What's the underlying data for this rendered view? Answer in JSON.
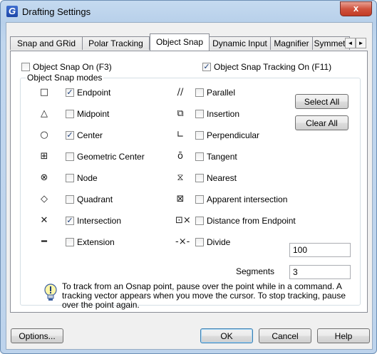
{
  "window": {
    "title": "Drafting Settings",
    "close_glyph": "x"
  },
  "tabs": [
    {
      "label": "Snap and GRid"
    },
    {
      "label": "Polar Tracking"
    },
    {
      "label": "Object Snap",
      "active": true
    },
    {
      "label": "Dynamic Input"
    },
    {
      "label": "Magnifier"
    },
    {
      "label": "Symmetr"
    }
  ],
  "tab_scroll": {
    "left": "◄",
    "right": "►"
  },
  "options": {
    "snap_on": {
      "label": "Object Snap On (F3)",
      "checked": false
    },
    "tracking_on": {
      "label": "Object Snap Tracking On (F11)",
      "checked": true
    }
  },
  "group_title": "Object Snap modes",
  "modes_left": [
    {
      "label": "Endpoint",
      "checked": true,
      "icon": "□"
    },
    {
      "label": "Midpoint",
      "checked": false,
      "icon": "△"
    },
    {
      "label": "Center",
      "checked": true,
      "icon": "○"
    },
    {
      "label": "Geometric Center",
      "checked": false,
      "icon": "⊞"
    },
    {
      "label": "Node",
      "checked": false,
      "icon": "⊗"
    },
    {
      "label": "Quadrant",
      "checked": false,
      "icon": "◇"
    },
    {
      "label": "Intersection",
      "checked": true,
      "icon": "✕"
    },
    {
      "label": "Extension",
      "checked": false,
      "icon": "━"
    }
  ],
  "modes_right": [
    {
      "label": "Parallel",
      "checked": false,
      "icon": "∕∕"
    },
    {
      "label": "Insertion",
      "checked": false,
      "icon": "⧉"
    },
    {
      "label": "Perpendicular",
      "checked": false,
      "icon": "∟"
    },
    {
      "label": "Tangent",
      "checked": false,
      "icon": "ō"
    },
    {
      "label": "Nearest",
      "checked": false,
      "icon": "⧖"
    },
    {
      "label": "Apparent intersection",
      "checked": false,
      "icon": "⊠"
    },
    {
      "label": "Distance from Endpoint",
      "checked": false,
      "icon": "⊡×"
    },
    {
      "label": "Divide",
      "checked": false,
      "icon": "-×-"
    }
  ],
  "distance_value": "100",
  "segments_label": "Segments",
  "segments_value": "3",
  "buttons": {
    "select_all": "Select All",
    "clear_all": "Clear All",
    "options": "Options...",
    "ok": "OK",
    "cancel": "Cancel",
    "help": "Help"
  },
  "tip": {
    "text": "To track from an Osnap point, pause over the point while in a command.  A tracking vector appears when you move the cursor.  To stop tracking, pause over the point again."
  }
}
